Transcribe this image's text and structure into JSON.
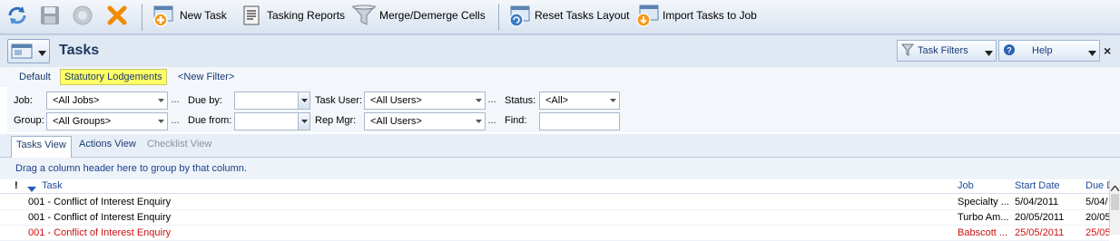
{
  "toolbar": {
    "items": [
      {
        "name": "refresh-button",
        "icon": "refresh-icon",
        "label": ""
      },
      {
        "name": "save-button",
        "icon": "save-icon",
        "label": ""
      },
      {
        "name": "disabled-button",
        "icon": "circle-icon",
        "label": ""
      },
      {
        "name": "delete-button",
        "icon": "close-x-icon",
        "label": ""
      },
      {
        "name": "new-task-button",
        "icon": "new-task-icon",
        "label": "New Task"
      },
      {
        "name": "tasking-reports-button",
        "icon": "report-icon",
        "label": "Tasking Reports"
      },
      {
        "name": "merge-demerge-button",
        "icon": "funnel-icon",
        "label": "Merge/Demerge Cells"
      },
      {
        "name": "reset-layout-button",
        "icon": "reset-layout-icon",
        "label": "Reset Tasks Layout"
      },
      {
        "name": "import-tasks-button",
        "icon": "import-icon",
        "label": "Import Tasks to Job"
      }
    ]
  },
  "header": {
    "title": "Tasks",
    "task_filters_label": "Task Filters",
    "help_label": "Help",
    "close_glyph": "×"
  },
  "filter_tabs": {
    "default": "Default",
    "statutory": "Statutory Lodgements",
    "new_filter": "<New Filter>"
  },
  "filters": {
    "job_label": "Job:",
    "job_value": "<All Jobs>",
    "group_label": "Group:",
    "group_value": "<All Groups>",
    "due_by_label": "Due by:",
    "due_by_value": "",
    "due_from_label": "Due from:",
    "due_from_value": "",
    "task_user_label": "Task User:",
    "task_user_value": "<All Users>",
    "rep_mgr_label": "Rep Mgr:",
    "rep_mgr_value": "<All Users>",
    "status_label": "Status:",
    "status_value": "<All>",
    "find_label": "Find:",
    "find_value": "",
    "ellipsis": "..."
  },
  "view_tabs": {
    "tasks": "Tasks View",
    "actions": "Actions View",
    "checklist": "Checklist View"
  },
  "grid": {
    "group_hint": "Drag a column header here to group by that column.",
    "columns": {
      "flag": "!",
      "task": "Task",
      "job": "Job",
      "start_date": "Start Date",
      "due_date": "Due D"
    },
    "rows": [
      {
        "task": "001 - Conflict of Interest Enquiry",
        "job": "Specialty ...",
        "start": "5/04/2011",
        "due": "5/04/",
        "overdue": false
      },
      {
        "task": "001 - Conflict of Interest Enquiry",
        "job": "Turbo Am...",
        "start": "20/05/2011",
        "due": "20/05",
        "overdue": false
      },
      {
        "task": "001 - Conflict of Interest Enquiry",
        "job": "Babscott ...",
        "start": "25/05/2011",
        "due": "25/05",
        "overdue": true
      }
    ]
  },
  "colors": {
    "accent": "#1f4a9b",
    "overdue": "#cc1111",
    "highlight_tab": "#ffff66"
  }
}
